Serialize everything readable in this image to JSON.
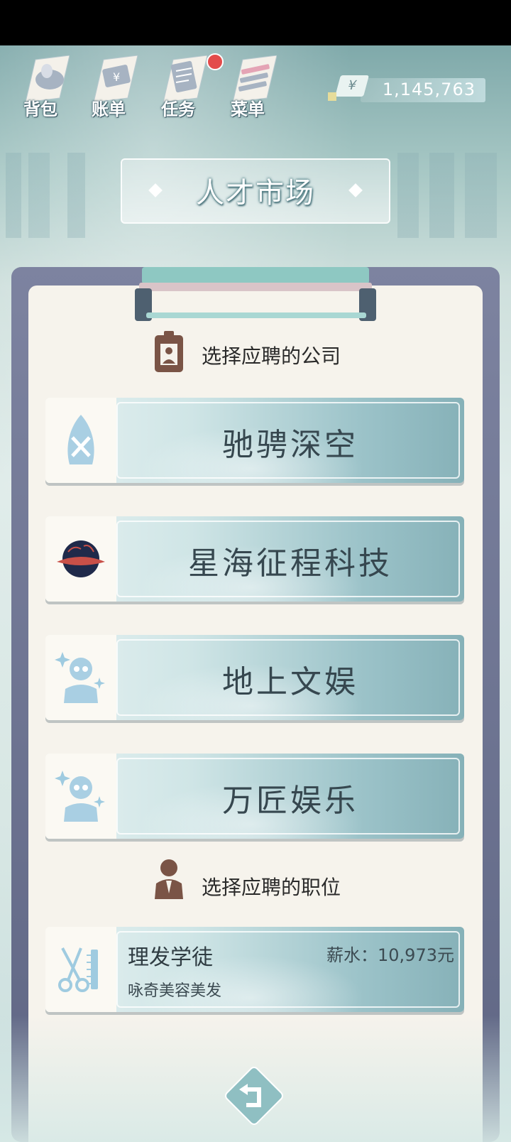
{
  "top_menu": [
    {
      "label": "背包",
      "icon": "backpack-icon"
    },
    {
      "label": "账单",
      "icon": "bill-icon"
    },
    {
      "label": "任务",
      "icon": "task-icon",
      "has_badge": true
    },
    {
      "label": "菜单",
      "icon": "menu-icon"
    }
  ],
  "currency": {
    "symbol": "¥",
    "amount": "1,145,763"
  },
  "page_title": "人才市场",
  "company_section": {
    "title": "选择应聘的公司",
    "companies": [
      {
        "name": "驰骋深空",
        "icon": "rocket-tools-icon"
      },
      {
        "name": "星海征程科技",
        "icon": "planet-logo-icon"
      },
      {
        "name": "地上文娱",
        "icon": "star-performer-icon"
      },
      {
        "name": "万匠娱乐",
        "icon": "star-performer-icon"
      }
    ]
  },
  "job_section": {
    "title": "选择应聘的职位",
    "jobs": [
      {
        "title": "理发学徒",
        "salary": "薪水：10,973元",
        "company": "咏奇美容美发",
        "icon": "scissors-comb-icon"
      }
    ]
  },
  "colors": {
    "accent": "#5f6684",
    "card": "#9cc3c9",
    "badge": "#e34b4b"
  }
}
